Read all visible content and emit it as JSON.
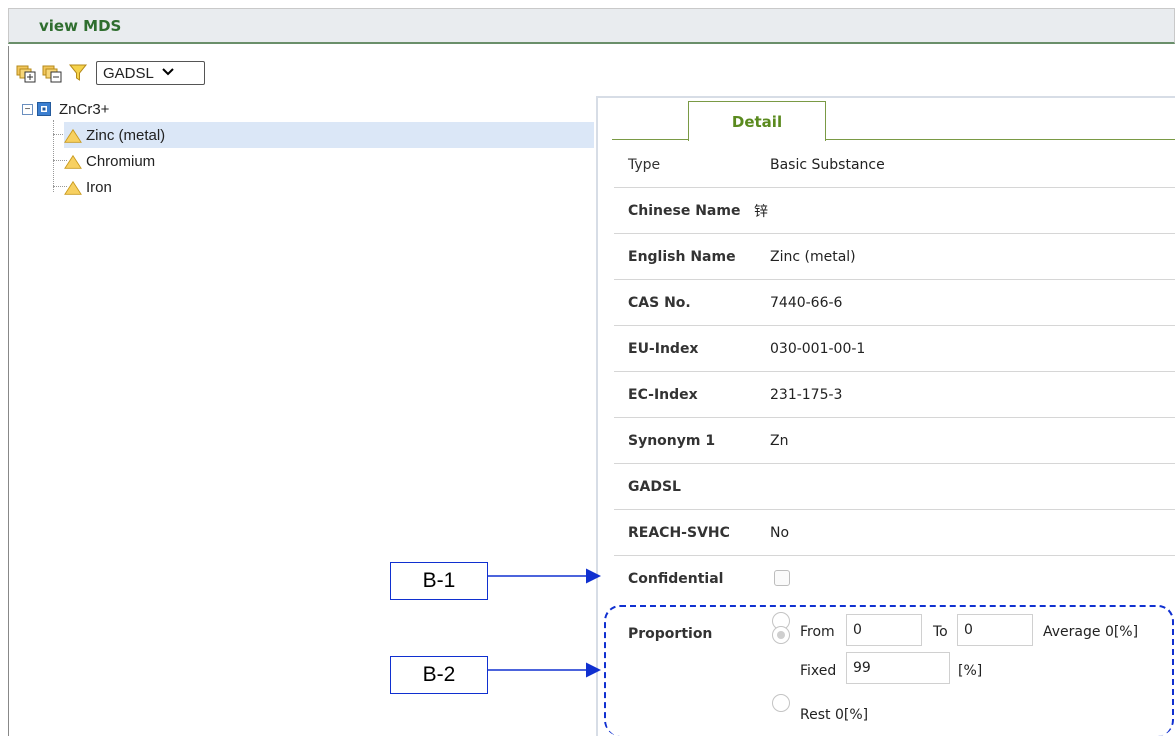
{
  "window": {
    "title": "view MDS"
  },
  "toolbar": {
    "filter_selected": "GADSL"
  },
  "tree": {
    "root": {
      "label": "ZnCr3+"
    },
    "children": [
      {
        "label": "Zinc (metal)",
        "selected": true
      },
      {
        "label": "Chromium",
        "selected": false
      },
      {
        "label": "Iron",
        "selected": false
      }
    ]
  },
  "detail": {
    "tab": "Detail",
    "rows": [
      {
        "label": "Type",
        "value": "Basic Substance"
      },
      {
        "label": "Chinese Name",
        "value": "锌"
      },
      {
        "label": "English Name",
        "value": "Zinc (metal)"
      },
      {
        "label": "CAS No.",
        "value": "7440-66-6"
      },
      {
        "label": "EU-Index",
        "value": "030-001-00-1"
      },
      {
        "label": "EC-Index",
        "value": "231-175-3"
      },
      {
        "label": "Synonym 1",
        "value": "Zn"
      },
      {
        "label": "GADSL",
        "value": ""
      },
      {
        "label": "REACH-SVHC",
        "value": "No"
      },
      {
        "label": "Confidential",
        "checked": false
      }
    ],
    "proportion": {
      "label": "Proportion",
      "from_label": "From",
      "from_value": "0",
      "to_label": "To",
      "to_value": "0",
      "average_text": "Average 0[%]",
      "fixed_label": "Fixed",
      "fixed_value": "99",
      "fixed_unit": "[%]",
      "rest_text": "Rest 0[%]",
      "selected": "fixed"
    }
  },
  "callouts": {
    "b1": "B-1",
    "b2": "B-2"
  },
  "colors": {
    "accent_green": "#5a8a1e",
    "callout_blue": "#1030d0",
    "selection_bg": "#dbe7f7"
  },
  "icons": [
    "expand-all-icon",
    "collapse-all-icon",
    "filter-icon",
    "chevron-down-icon",
    "collapse-node-icon",
    "mixture-icon",
    "warning-triangle-icon"
  ]
}
